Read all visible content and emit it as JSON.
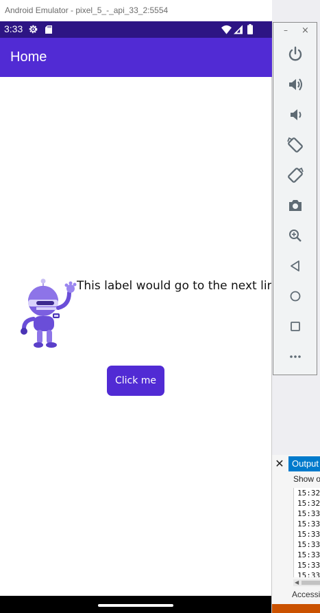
{
  "emulator": {
    "title": "Android Emulator - pixel_5_-_api_33_2:5554",
    "status_time": "3:33",
    "toolbar": {
      "minimize": "–",
      "close": "×"
    }
  },
  "app": {
    "appbar_title": "Home",
    "label_text": "This label would go to the next line",
    "button_label": "Click me"
  },
  "vs": {
    "close_glyph": "✕",
    "output_tab": "Output",
    "show_output": "Show o",
    "log_lines": [
      "15:32",
      "15:32",
      "15:33",
      "15:33",
      "15:33",
      "15:33",
      "15:33",
      "15:33",
      "15:33"
    ],
    "accessibility": "Accessi"
  },
  "icons": [
    "settings-icon",
    "sd-card-icon",
    "wifi-icon",
    "signal-icon",
    "battery-icon",
    "power-icon",
    "volume-up-icon",
    "volume-down-icon",
    "rotate-left-icon",
    "rotate-right-icon",
    "camera-icon",
    "zoom-icon",
    "back-icon",
    "home-icon",
    "overview-icon",
    "more-icon"
  ],
  "colors": {
    "appbar": "#512bd4",
    "statusbar": "#2d1584",
    "button": "#512bd4",
    "vs_accent": "#007acc",
    "vs_status": "#ca5100"
  }
}
